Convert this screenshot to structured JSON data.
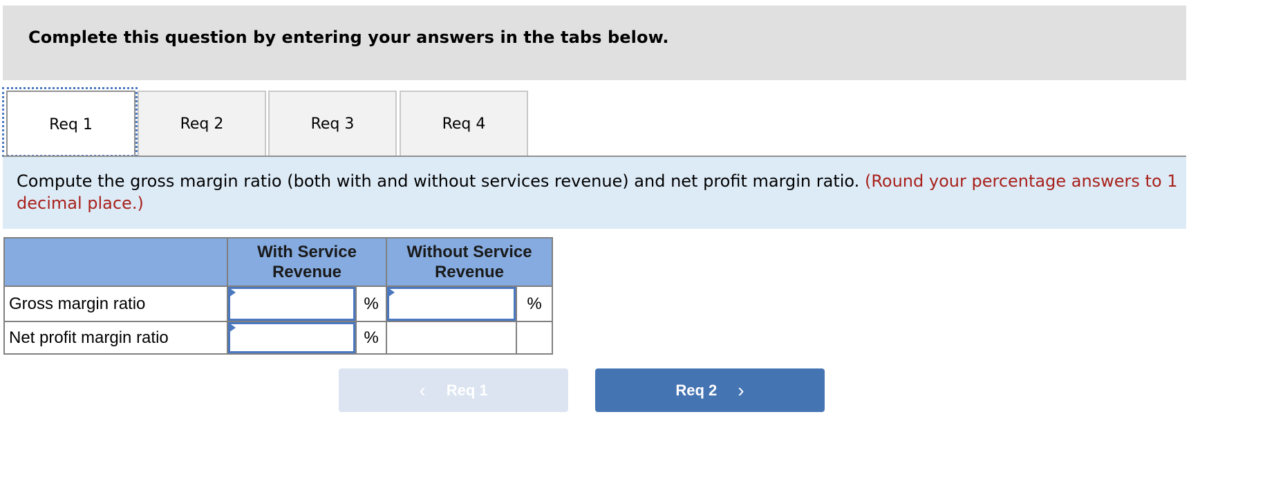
{
  "header": {
    "title": "Complete this question by entering your answers in the tabs below."
  },
  "tabs": [
    {
      "label": "Req 1",
      "active": true
    },
    {
      "label": "Req 2",
      "active": false
    },
    {
      "label": "Req 3",
      "active": false
    },
    {
      "label": "Req 4",
      "active": false
    }
  ],
  "instruction": {
    "text": "Compute the gross margin ratio (both with and without services revenue) and net profit margin ratio.",
    "note": "(Round your percentage answers to 1 decimal place.)"
  },
  "table": {
    "columns": [
      "",
      "With Service Revenue",
      "Without Service Revenue"
    ],
    "col_with_line1": "With Service",
    "col_with_line2": "Revenue",
    "col_without_line1": "Without Service",
    "col_without_line2": "Revenue",
    "rows": [
      {
        "label": "Gross margin ratio",
        "with_value": "",
        "with_unit": "%",
        "without_value": "",
        "without_unit": "%"
      },
      {
        "label": "Net profit margin ratio",
        "with_value": "",
        "with_unit": "%",
        "without_value": null,
        "without_unit": ""
      }
    ]
  },
  "navigation": {
    "prev_label": "Req 1",
    "prev_enabled": false,
    "next_label": "Req 2",
    "next_enabled": true,
    "prev_icon": "chevron-left-icon",
    "next_icon": "chevron-right-icon"
  },
  "colors": {
    "header_bg": "#e0e0e0",
    "instruction_bg": "#ddebf7",
    "note_red": "#a8201a",
    "table_header_bg": "#85abe0",
    "input_border": "#4a78c0",
    "next_button": "#4574b3",
    "prev_button_disabled": "#dbe4f0"
  }
}
